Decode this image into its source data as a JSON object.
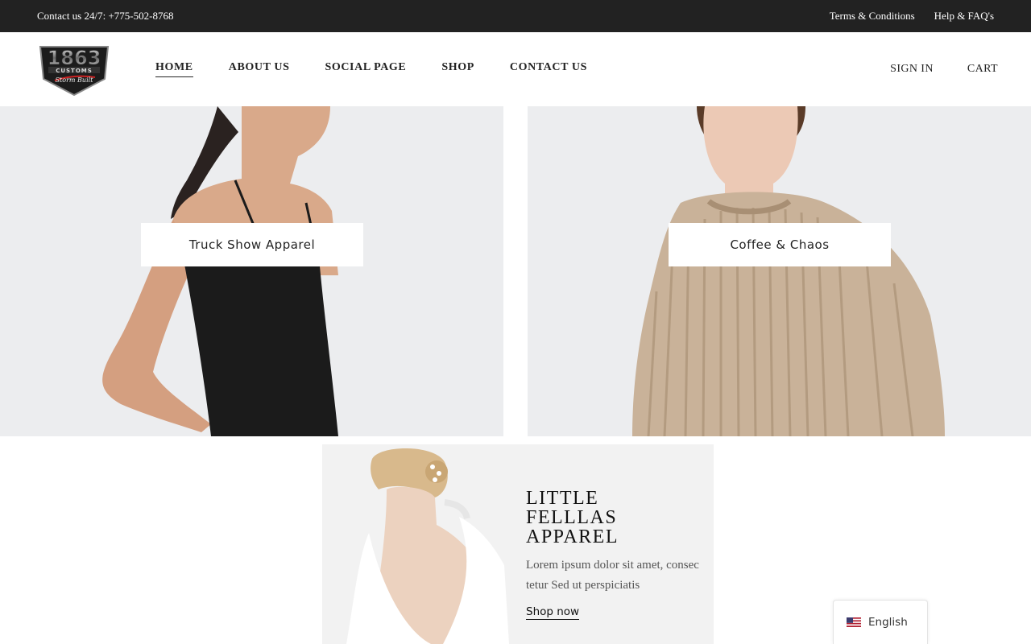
{
  "topbar": {
    "contact": "Contact us 24/7: +775-502-8768",
    "terms": "Terms & Conditions",
    "help": "Help & FAQ's"
  },
  "header": {
    "logo_text": "1863 CUSTOMS Storm Built",
    "nav": {
      "home": "HOME",
      "about": "ABOUT US",
      "social": "SOCIAL PAGE",
      "shop": "SHOP",
      "contact": "CONTACT US"
    },
    "active_nav": "HOME",
    "signin": "SIGN IN",
    "cart": "CART"
  },
  "categories": [
    {
      "label": "Truck Show Apparel"
    },
    {
      "label": "Coffee & Chaos"
    }
  ],
  "promo": {
    "title": "LITTLE FELLLAS APPAREL",
    "text": "Lorem ipsum dolor sit amet, consec tetur Sed ut perspiciatis",
    "cta": "Shop now"
  },
  "language": {
    "label": "English",
    "flag_icon": "us-flag-icon"
  }
}
